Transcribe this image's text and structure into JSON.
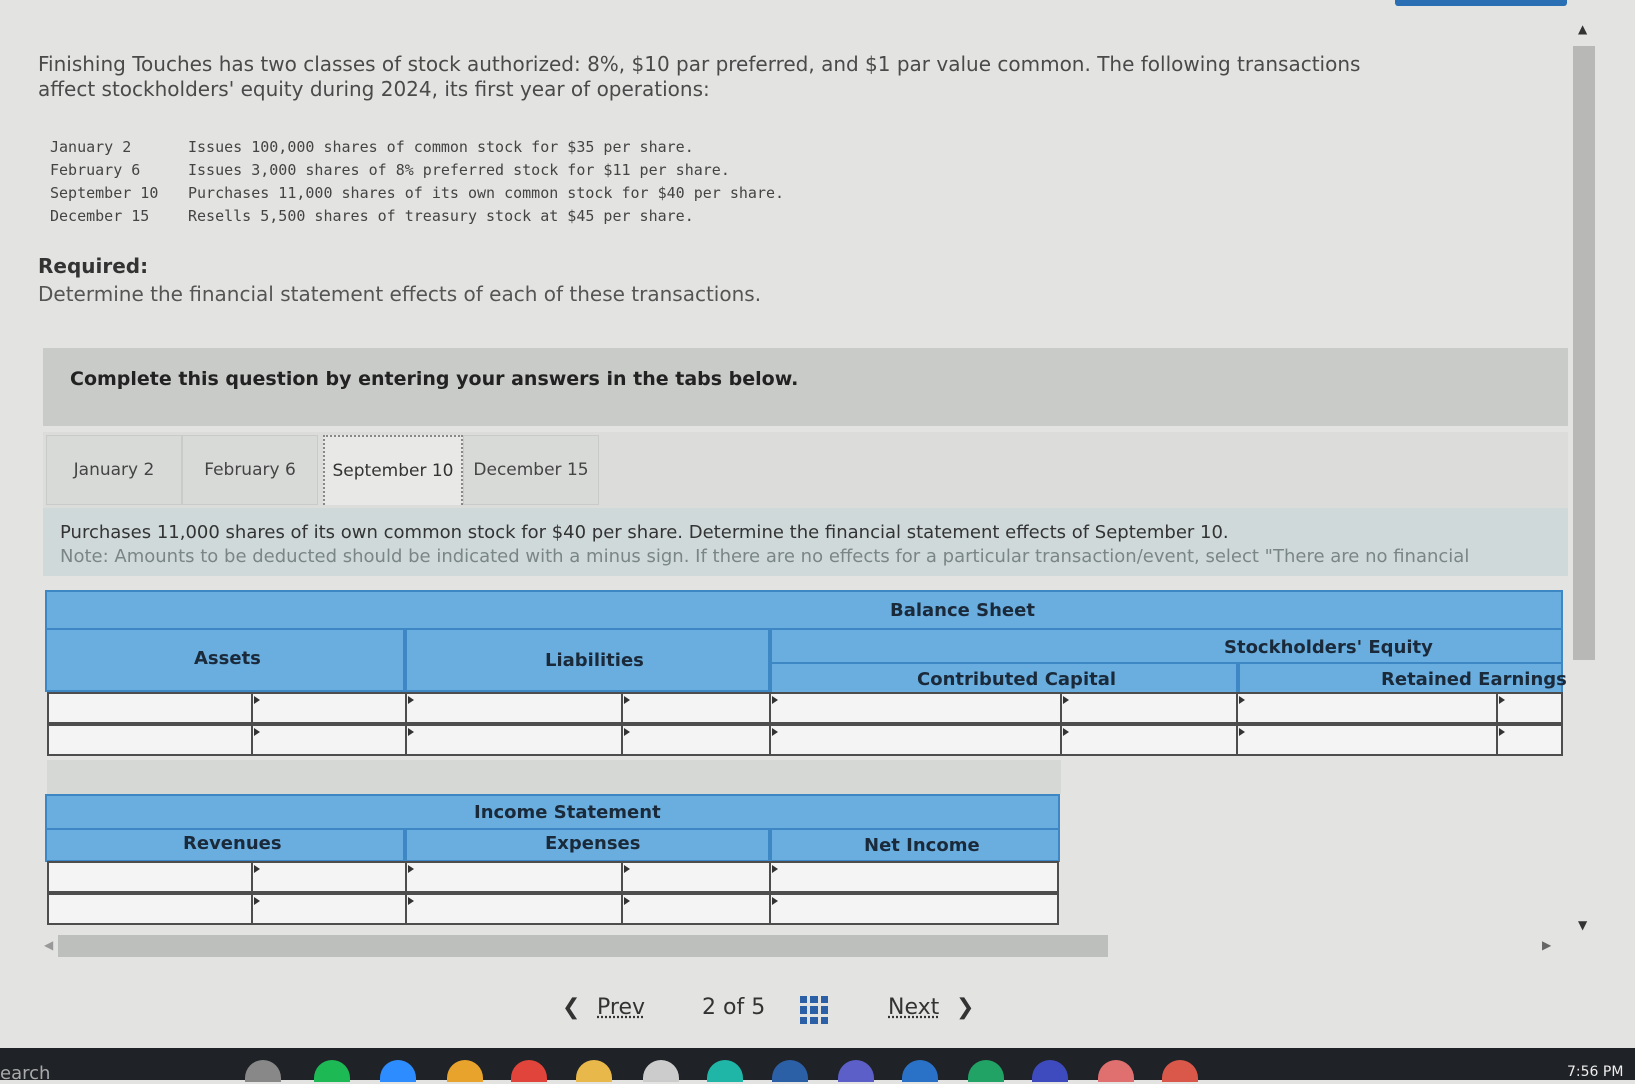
{
  "intro": "Finishing Touches has two classes of stock authorized: 8%, $10 par preferred, and $1 par value common. The following transactions affect stockholders' equity during 2024, its first year of operations:",
  "transactions": [
    {
      "date": "January 2",
      "text": "Issues 100,000 shares of common stock for $35 per share."
    },
    {
      "date": "February 6",
      "text": "Issues 3,000 shares of 8% preferred stock for $11 per share."
    },
    {
      "date": "September 10",
      "text": "Purchases 11,000 shares of its own common stock for $40 per share."
    },
    {
      "date": "December 15",
      "text": "Resells 5,500 shares of treasury stock at $45 per share."
    }
  ],
  "required": {
    "title": "Required:",
    "text": "Determine the financial statement effects of each of these transactions."
  },
  "banner": "Complete this question by entering your answers in the tabs below.",
  "tabs": [
    {
      "label": "January 2",
      "active": false
    },
    {
      "label": "February 6",
      "active": false
    },
    {
      "label": "September 10",
      "active": true
    },
    {
      "label": "December 15",
      "active": false
    }
  ],
  "question": {
    "line1": "Purchases 11,000 shares of its own common stock for $40 per share. Determine the financial statement effects of September 10.",
    "line2": "Note: Amounts to be deducted should be indicated with a minus sign. If there are no effects for a particular transaction/event, select \"There are no financial"
  },
  "balance_sheet": {
    "title": "Balance Sheet",
    "assets": "Assets",
    "liabilities": "Liabilities",
    "stockholders_equity": "Stockholders' Equity",
    "contributed_capital": "Contributed Capital",
    "retained_earnings": "Retained Earnings"
  },
  "income_statement": {
    "title": "Income Statement",
    "revenues": "Revenues",
    "expenses": "Expenses",
    "net_income": "Net Income"
  },
  "nav": {
    "prev": "Prev",
    "page": "2 of 5",
    "next": "Next"
  },
  "taskbar": {
    "search": "earch",
    "time": "7:56 PM"
  },
  "colors": {
    "header_blue": "#6aaedf",
    "header_border": "#3d87c4",
    "link_blue": "#2b5fa6"
  }
}
